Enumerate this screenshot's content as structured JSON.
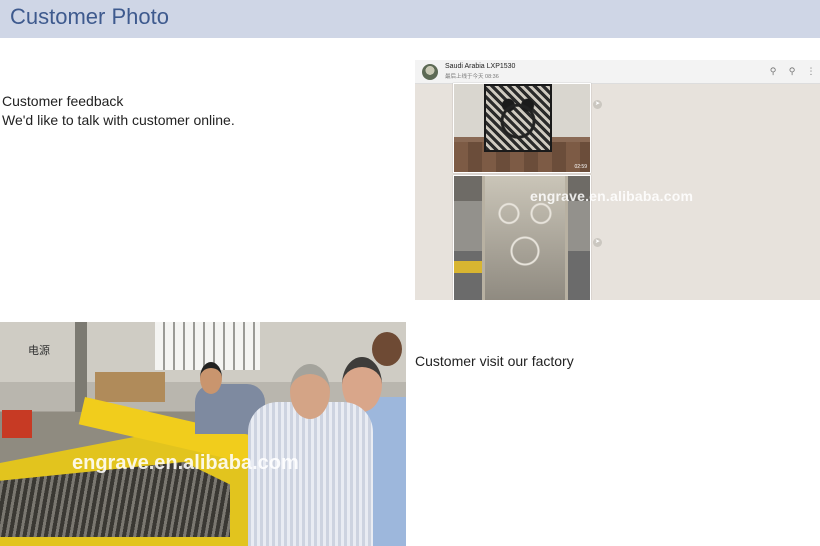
{
  "header": {
    "title": "Customer Photo",
    "colors": {
      "background": "#cfd6e6",
      "title": "#3e5a8e"
    }
  },
  "feedback": {
    "line1": "Customer feedback",
    "line2": "We'd like to talk with customer online."
  },
  "chat": {
    "contact_name": "Saudi Arabia LXP1530",
    "status": "最后上线于今天 08:36",
    "icons": [
      "search-icon",
      "attach-icon",
      "more-icon"
    ],
    "photo_time": "02:59",
    "watermark": "engrave.en.alibaba.com"
  },
  "factory": {
    "sign": "电源",
    "caption": "Customer visit our factory",
    "watermark": "engrave.en.alibaba.com"
  }
}
